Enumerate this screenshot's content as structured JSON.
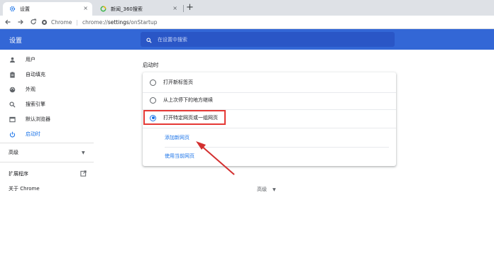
{
  "tabs": [
    {
      "title": "设置",
      "icon": "gear-icon"
    },
    {
      "title": "新闻_360搜索",
      "icon": "360-search-icon"
    }
  ],
  "new_tab": "+",
  "close_glyph": "×",
  "omnibox": {
    "site": "Chrome",
    "url_host": "chrome://",
    "url_path_bold": "settings",
    "url_path": "/onStartup"
  },
  "header": {
    "title": "设置",
    "search_placeholder": "在设置中搜索"
  },
  "sidebar": {
    "items": [
      {
        "label": "用户",
        "icon": "person-icon"
      },
      {
        "label": "自动填充",
        "icon": "clipboard-icon"
      },
      {
        "label": "外观",
        "icon": "palette-icon"
      },
      {
        "label": "搜索引擎",
        "icon": "search-icon"
      },
      {
        "label": "默认浏览器",
        "icon": "browser-icon"
      },
      {
        "label": "启动时",
        "icon": "power-icon"
      }
    ],
    "advanced": "高级",
    "extensions": "扩展程序",
    "about": "关于 Chrome"
  },
  "startup": {
    "section_title": "启动时",
    "options": [
      {
        "label": "打开新标签页",
        "checked": false
      },
      {
        "label": "从上次停下的地方继续",
        "checked": false
      },
      {
        "label": "打开特定网页或一组网页",
        "checked": true
      }
    ],
    "add_page_link": "添加新网页",
    "use_current_link": "使用当前网页"
  },
  "advanced_footer": "高级",
  "colors": {
    "accent": "#1a73e8",
    "header": "#3367d6",
    "highlight": "#e53935"
  }
}
